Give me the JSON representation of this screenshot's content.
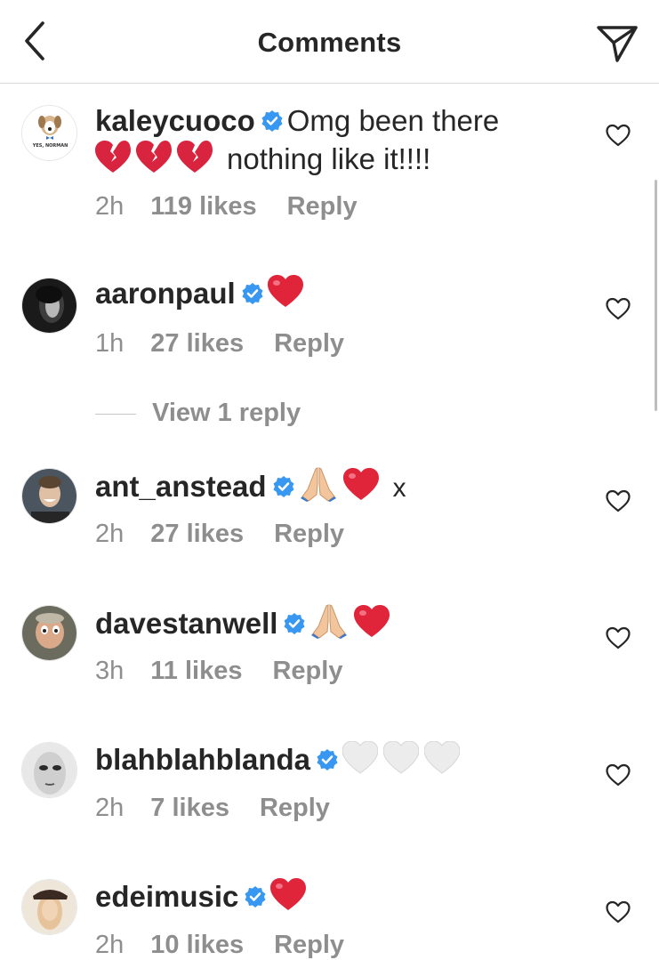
{
  "header": {
    "title": "Comments",
    "back_icon": "chevron-left-icon",
    "share_icon": "paper-plane-icon"
  },
  "colors": {
    "verified_blue": "#3897f0",
    "secondary_text": "#8e8e8e",
    "divider": "#dbdbdb",
    "red_heart": "#e0245e"
  },
  "comments": [
    {
      "username": "kaleycuoco",
      "verified": true,
      "text": "Omg been there",
      "text2": "nothing like it!!!!",
      "emojis": [
        "broken-heart",
        "broken-heart",
        "broken-heart"
      ],
      "time": "2h",
      "likes": "119 likes",
      "reply": "Reply",
      "avatar_logo_text": "YES, NORMAN"
    },
    {
      "username": "aaronpaul",
      "verified": true,
      "text": "",
      "emojis": [
        "red-heart"
      ],
      "time": "1h",
      "likes": "27 likes",
      "reply": "Reply",
      "view_replies": "View 1 reply"
    },
    {
      "username": "ant_anstead",
      "verified": true,
      "text": "x",
      "emojis": [
        "folded-hands",
        "red-heart"
      ],
      "time": "2h",
      "likes": "27 likes",
      "reply": "Reply"
    },
    {
      "username": "davestanwell",
      "verified": true,
      "text": "",
      "emojis": [
        "folded-hands",
        "red-heart"
      ],
      "time": "3h",
      "likes": "11 likes",
      "reply": "Reply"
    },
    {
      "username": "blahblahblanda",
      "verified": true,
      "text": "",
      "emojis": [
        "white-heart",
        "white-heart",
        "white-heart"
      ],
      "time": "2h",
      "likes": "7 likes",
      "reply": "Reply"
    },
    {
      "username": "edeimusic",
      "verified": true,
      "text": "",
      "emojis": [
        "red-heart"
      ],
      "time": "2h",
      "likes": "10 likes",
      "reply": "Reply"
    }
  ]
}
